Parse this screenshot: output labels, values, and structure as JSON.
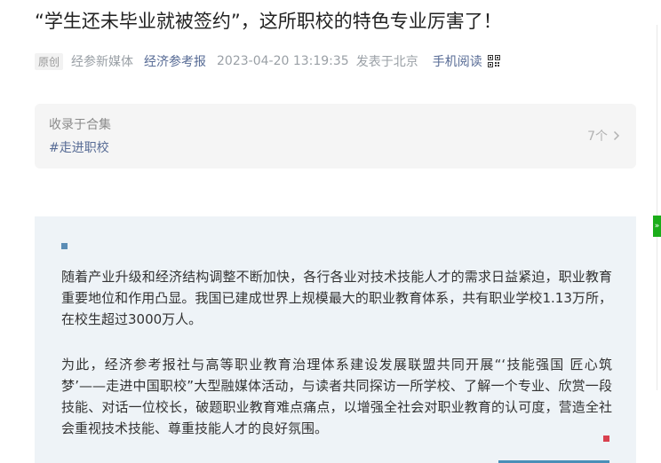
{
  "article": {
    "title": "“学生还未毕业就被签约”，这所职校的特色专业厉害了！",
    "original_tag": "原创",
    "author": "经参新媒体",
    "account": "经济参考报",
    "datetime": "2023-04-20 13:19:35",
    "location": "发表于北京",
    "mobile_read": "手机阅读",
    "qr_icon": "qr-code-icon"
  },
  "collection": {
    "label": "收录于合集",
    "tag": "#走进职校",
    "count": "7个",
    "chevron_icon": "chevron-right-icon"
  },
  "body": {
    "paragraph1": "随着产业升级和经济结构调整不断加快，各行各业对技术技能人才的需求日益紧迫，职业教育重要地位和作用凸显。我国已建成世界上规模最大的职业教育体系，共有职业学校1.13万所，在校生超过3000万人。",
    "paragraph2": "为此，经济参考报社与高等职业教育治理体系建设发展联盟共同开展“‘技能强国 匠心筑梦’——走进中国职校”大型融媒体活动，与读者共同探访一所学校、了解一个专业、欣赏一段技能、对话一位校长，破题职业教育难点痛点，以增强全社会对职业教育的认可度，营造全社会重视技术技能、尊重技能人才的良好氛围。",
    "intro_bg_color": "#eef3f7",
    "accent_blue": "#5b8db6",
    "accent_red": "#d9414f"
  },
  "side_tab": {
    "label": "»"
  }
}
